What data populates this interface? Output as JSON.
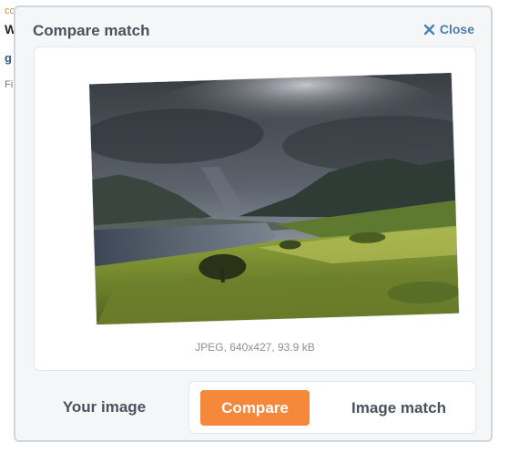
{
  "background_fragments": [
    "co",
    "W",
    "g",
    "Fi"
  ],
  "modal": {
    "title": "Compare match",
    "close_label": "Close",
    "close_icon": "close-icon"
  },
  "image_card": {
    "meta": "JPEG, 640x427, 93.9 kB"
  },
  "tabs": {
    "your_image": "Your image",
    "compare": "Compare",
    "image_match": "Image match"
  },
  "colors": {
    "accent": "#f5883b",
    "link": "#4a7fb5",
    "modal_bg": "#f5f6f8",
    "border": "#cfd6e0"
  }
}
